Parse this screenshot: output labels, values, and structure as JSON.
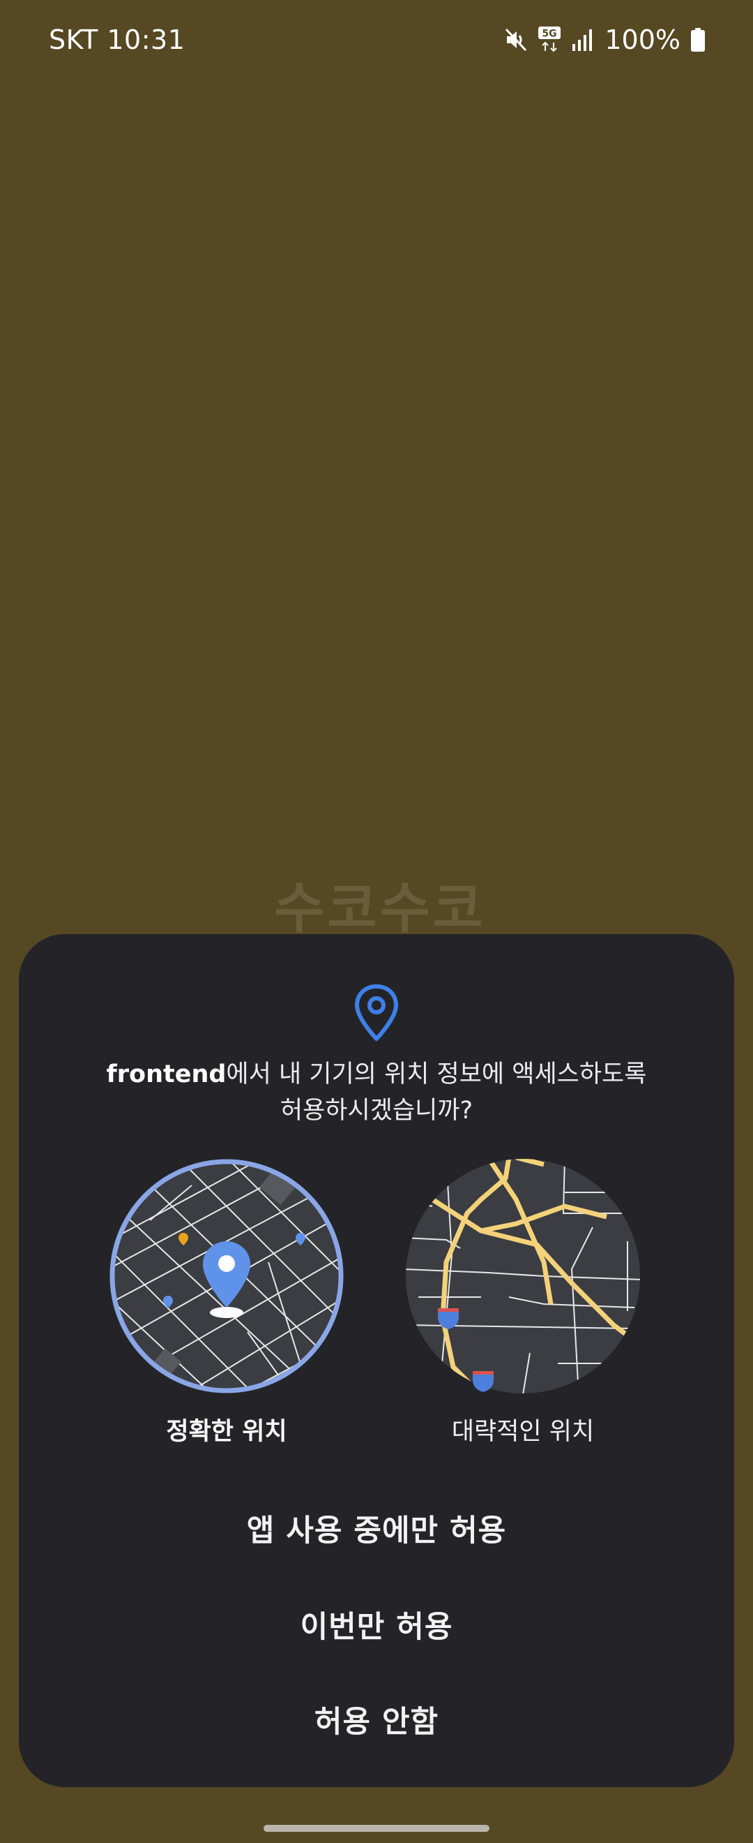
{
  "status_bar": {
    "carrier_time": "SKT 10:31",
    "network": "5G",
    "battery": "100%",
    "icons": [
      "mute-icon",
      "5g-icon",
      "signal-icon",
      "battery-icon"
    ]
  },
  "background": {
    "partial_title": "수코수코"
  },
  "dialog": {
    "app_name": "frontend",
    "question_rest": "에서 내 기기의 위치 정보에 액세스하도록",
    "question_line2": "허용하시겠습니까?",
    "precise_label": "정확한 위치",
    "approximate_label": "대략적인 위치",
    "selected_option": "정확한 위치",
    "actions": {
      "while_using": "앱 사용 중에만 허용",
      "only_this_time": "이번만 허용",
      "deny": "허용 안함"
    }
  },
  "colors": {
    "background": "#564823",
    "sheet": "#242428",
    "accent_blue": "#3f7fe8",
    "selection_ring": "#8aa6e6",
    "map_bg": "#3b3d42",
    "road_yellow": "#f4d27a"
  }
}
